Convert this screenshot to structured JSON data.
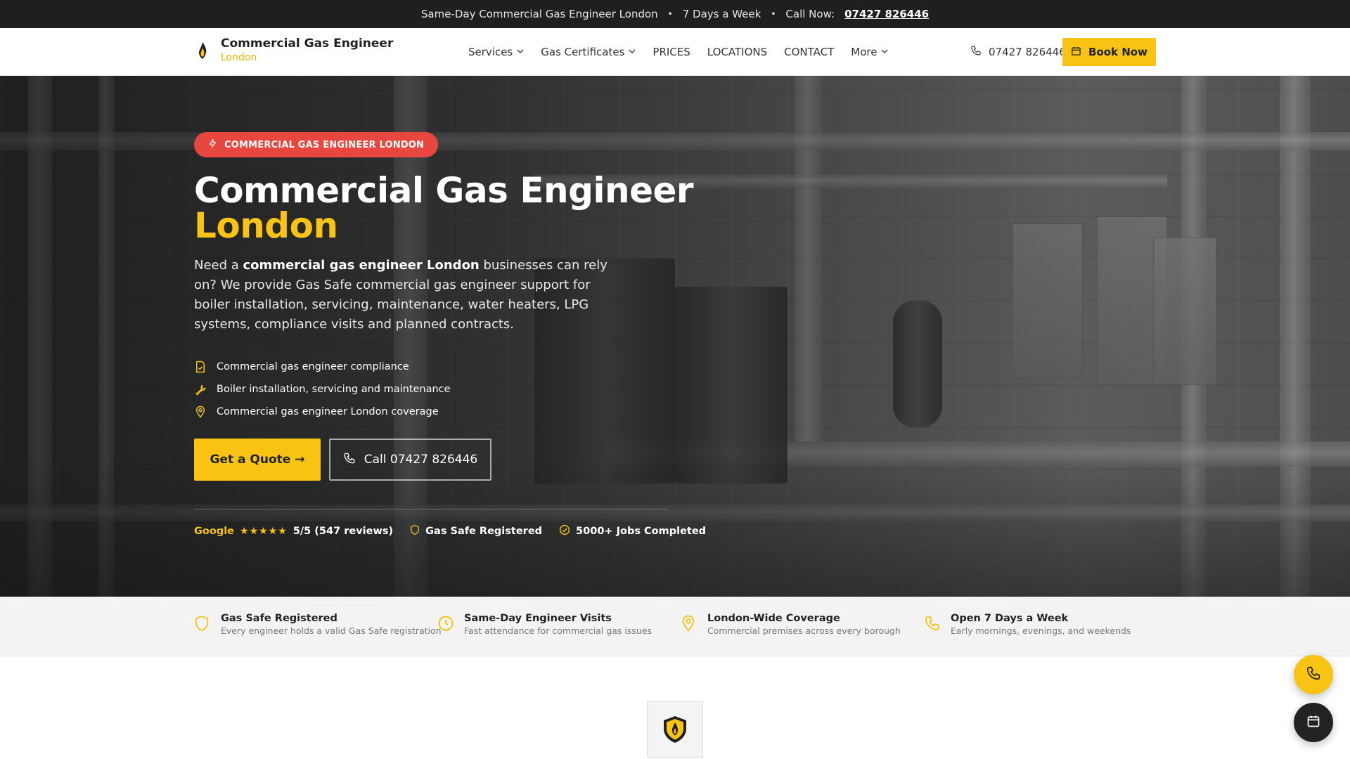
{
  "topbar": {
    "text": "Same-Day Commercial Gas Engineer London",
    "availability": "7 Days a Week",
    "call_label": "Call Now:",
    "phone": "07427 826446"
  },
  "brand": {
    "name": "Commercial Gas Engineer",
    "city": "London",
    "logo_icon": "flame-icon"
  },
  "nav": {
    "items": [
      {
        "label": "Services",
        "dropdown": true
      },
      {
        "label": "Gas Certificates",
        "dropdown": true
      },
      {
        "label": "PRICES",
        "dropdown": false
      },
      {
        "label": "LOCATIONS",
        "dropdown": false
      },
      {
        "label": "CONTACT",
        "dropdown": false
      },
      {
        "label": "More",
        "dropdown": true
      }
    ],
    "phone": "07427 826446",
    "book_label": "Book Now"
  },
  "hero": {
    "badge": "COMMERCIAL GAS ENGINEER LONDON",
    "title_line1": "Commercial Gas Engineer",
    "title_line2": "London",
    "desc_pre": "Need a ",
    "desc_bold": "commercial gas engineer London",
    "desc_post": " businesses can rely on? We provide Gas Safe commercial gas engineer support for boiler installation, servicing, maintenance, water heaters, LPG systems, compliance visits and planned contracts.",
    "features": [
      {
        "icon": "document-check-icon",
        "text": "Commercial gas engineer compliance"
      },
      {
        "icon": "wrench-icon",
        "text": "Boiler installation, servicing and maintenance"
      },
      {
        "icon": "map-pin-icon",
        "text": "Commercial gas engineer London coverage"
      }
    ],
    "quote_label": "Get a Quote →",
    "call_label": "Call 07427 826446",
    "trust": {
      "google": "Google",
      "stars": "★★★★★",
      "rating": "5/5 (547 reviews)",
      "gas_safe": "Gas Safe Registered",
      "jobs": "5000+ Jobs Completed"
    }
  },
  "strip": [
    {
      "icon": "shield-icon",
      "title": "Gas Safe Registered",
      "desc": "Every engineer holds a valid Gas Safe registration"
    },
    {
      "icon": "clock-icon",
      "title": "Same-Day Engineer Visits",
      "desc": "Fast attendance for commercial gas issues"
    },
    {
      "icon": "map-pin-icon",
      "title": "London-Wide Coverage",
      "desc": "Commercial premises across every borough"
    },
    {
      "icon": "phone-icon",
      "title": "Open 7 Days a Week",
      "desc": "Early mornings, evenings, and weekends"
    }
  ],
  "colors": {
    "accent": "#f8c313",
    "badge": "#e8473f",
    "dark": "#1f1f1f"
  }
}
